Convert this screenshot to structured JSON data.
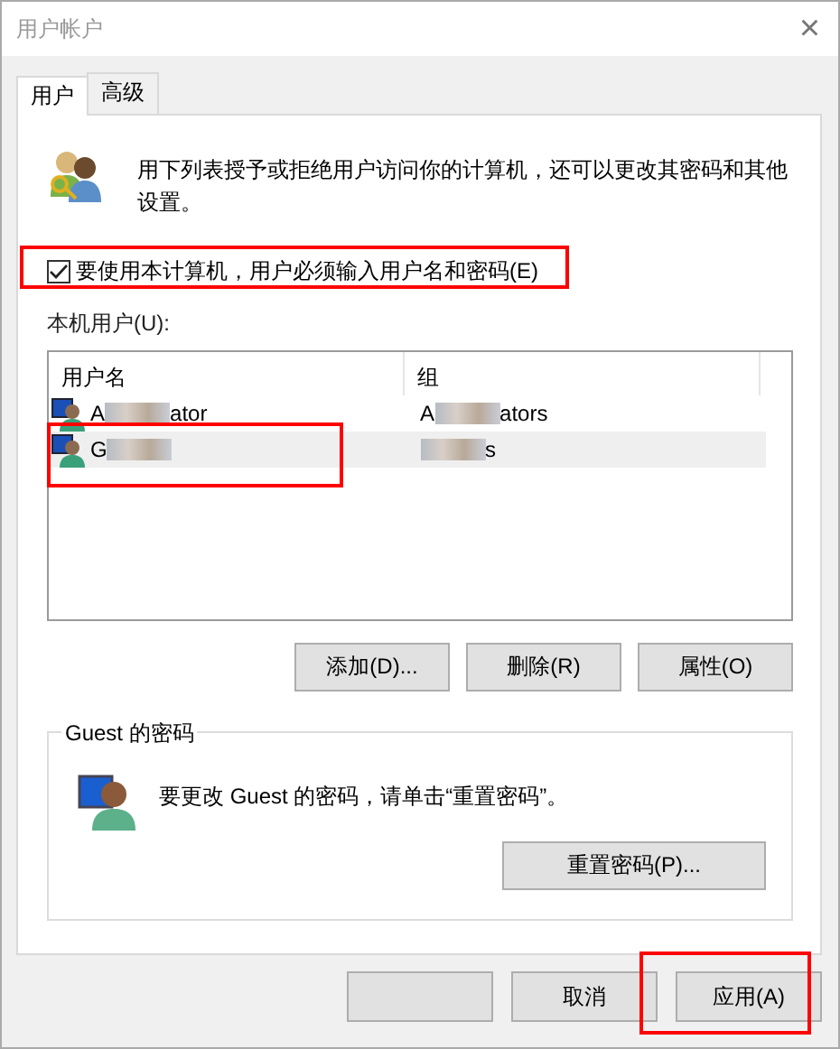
{
  "window": {
    "title": "用户帐户",
    "close": "×"
  },
  "tabs": [
    {
      "label": "用户",
      "selected": true
    },
    {
      "label": "高级",
      "selected": false
    }
  ],
  "description": "用下列表授予或拒绝用户访问你的计算机，还可以更改其密码和其他设置。",
  "require_login": {
    "label": "要使用本计算机，用户必须输入用户名和密码(E)",
    "checked": true,
    "highlighted": true
  },
  "users_label": "本机用户(U):",
  "table": {
    "columns": [
      "用户名",
      "组"
    ],
    "rows": [
      {
        "selected": false,
        "highlighted": false,
        "cells": [
          {
            "before": "A",
            "after": "ator"
          },
          {
            "before": "A",
            "after": "ators"
          }
        ]
      },
      {
        "selected": true,
        "highlighted": true,
        "cells": [
          {
            "before": "G"
          },
          {
            "after": "s"
          }
        ]
      }
    ]
  },
  "list_buttons": [
    "添加(D)...",
    "删除(R)",
    "属性(O)"
  ],
  "password_group": {
    "title": "Guest 的密码",
    "text": "要更改 Guest 的密码，请单击“重置密码”。",
    "button": "重置密码(P)..."
  },
  "dialog_buttons": [
    {
      "highlighted": false
    },
    {
      "label": "取消",
      "highlighted": false
    },
    {
      "label": "应用(A)",
      "highlighted": true
    }
  ]
}
